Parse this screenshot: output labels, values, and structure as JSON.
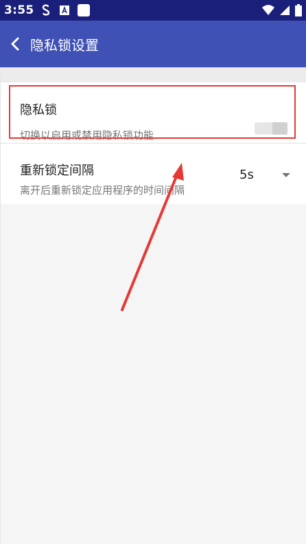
{
  "status_bar": {
    "time": "3:55",
    "icons": [
      "s-app-icon",
      "a-app-icon",
      "square-app-icon",
      "wifi-icon",
      "cellular-icon",
      "battery-icon"
    ]
  },
  "app_bar": {
    "title": "隐私锁设置",
    "back_icon": "chevron-left-icon"
  },
  "settings": {
    "privacy_lock": {
      "title": "隐私锁",
      "summary": "切换以启用或禁用隐私锁功能",
      "enabled": false
    },
    "relock_interval": {
      "title": "重新锁定间隔",
      "summary": "离开后重新锁定应用程序的时间间隔",
      "value": "5s"
    }
  },
  "colors": {
    "status_bar": "#1a1f7a",
    "app_bar": "#3f51b5",
    "highlight": "#e53935",
    "arrow": "#e53935"
  }
}
